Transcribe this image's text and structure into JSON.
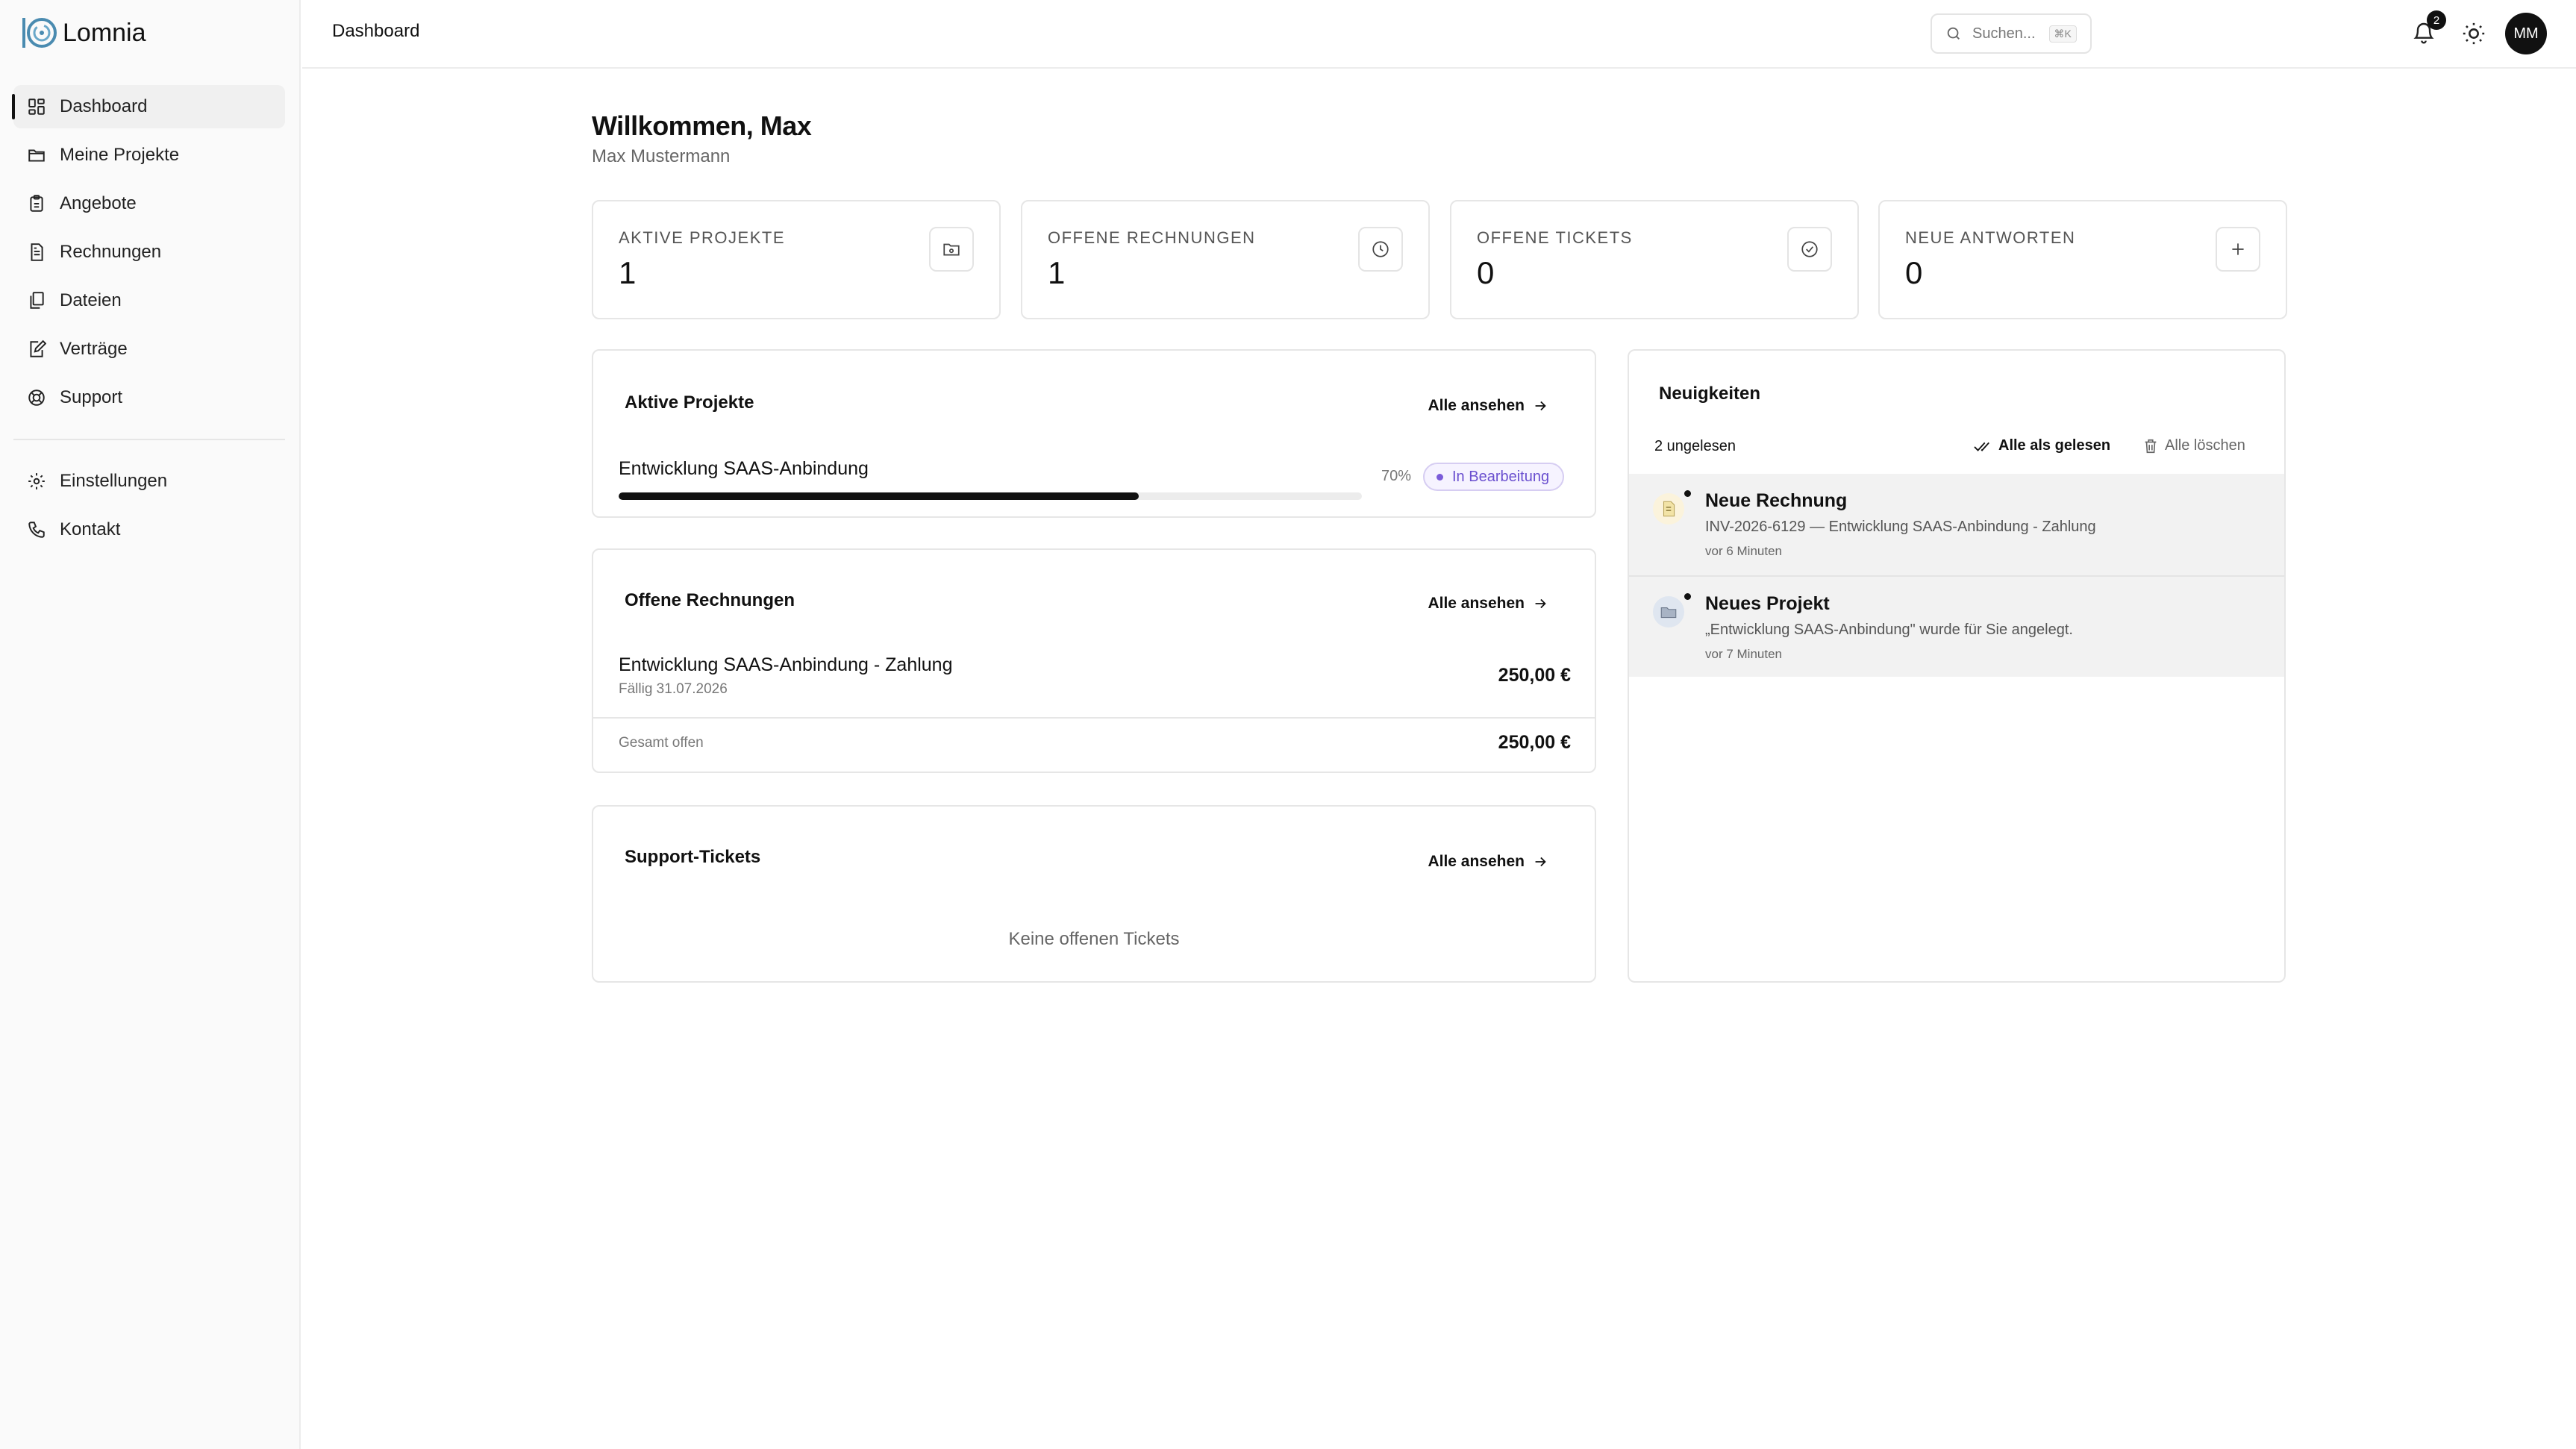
{
  "app": {
    "brand": "Lomnia"
  },
  "sidebar": {
    "items": [
      {
        "label": "Dashboard",
        "icon": "grid-icon"
      },
      {
        "label": "Meine Projekte",
        "icon": "folder-icon"
      },
      {
        "label": "Angebote",
        "icon": "clipboard-icon"
      },
      {
        "label": "Rechnungen",
        "icon": "document-icon"
      },
      {
        "label": "Dateien",
        "icon": "files-icon"
      },
      {
        "label": "Verträge",
        "icon": "contract-icon"
      },
      {
        "label": "Support",
        "icon": "lifebuoy-icon"
      }
    ],
    "secondary": [
      {
        "label": "Einstellungen",
        "icon": "gear-icon"
      },
      {
        "label": "Kontakt",
        "icon": "phone-icon"
      }
    ]
  },
  "topbar": {
    "title": "Dashboard",
    "search_placeholder": "Suchen...",
    "search_shortcut": "⌘K",
    "notification_count": "2",
    "avatar_initials": "MM"
  },
  "welcome": {
    "title": "Willkommen, Max",
    "name": "Max Mustermann"
  },
  "stats": [
    {
      "label": "AKTIVE PROJEKTE",
      "value": "1",
      "icon": "folder-icon"
    },
    {
      "label": "OFFENE RECHNUNGEN",
      "value": "1",
      "icon": "clock-icon"
    },
    {
      "label": "OFFENE TICKETS",
      "value": "0",
      "icon": "check-circle-icon"
    },
    {
      "label": "NEUE ANTWORTEN",
      "value": "0",
      "icon": "plus-icon"
    }
  ],
  "active_projects": {
    "title": "Aktive Projekte",
    "see_all": "Alle ansehen",
    "project": {
      "name": "Entwicklung SAAS-Anbindung",
      "progress": 70,
      "progress_label": "70%",
      "status": "In Bearbeitung"
    }
  },
  "open_invoices": {
    "title": "Offene Rechnungen",
    "see_all": "Alle ansehen",
    "invoice": {
      "name": "Entwicklung SAAS-Anbindung - Zahlung",
      "due": "Fällig 31.07.2026",
      "amount": "250,00 €"
    },
    "total_label": "Gesamt offen",
    "total_amount": "250,00 €"
  },
  "support_tickets": {
    "title": "Support-Tickets",
    "see_all": "Alle ansehen",
    "empty": "Keine offenen Tickets"
  },
  "news": {
    "title": "Neuigkeiten",
    "unread": "2 ungelesen",
    "mark_all_read": "Alle als gelesen",
    "delete_all": "Alle löschen",
    "items": [
      {
        "title": "Neue Rechnung",
        "text": "INV-2026-6129 — Entwicklung SAAS-Anbindung - Zahlung",
        "time": "vor 6 Minuten",
        "icon": "invoice-icon"
      },
      {
        "title": "Neues Projekt",
        "text": "„Entwicklung SAAS-Anbindung\" wurde für Sie angelegt.",
        "time": "vor 7 Minuten",
        "icon": "project-icon"
      }
    ]
  },
  "colors": {
    "accent": "#111111",
    "status_purple": "#6a4fcf",
    "status_bg": "#f6f3ff"
  }
}
